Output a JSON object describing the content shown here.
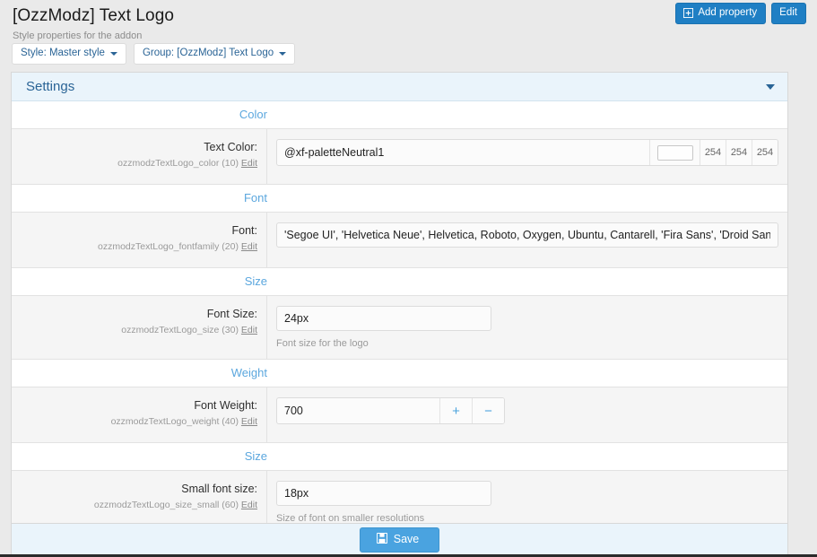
{
  "header": {
    "title": "[OzzModz] Text Logo",
    "subtitle": "Style properties for the addon",
    "add_property_label": "Add property",
    "add_property_icon": "plus-square-icon",
    "edit_label": "Edit"
  },
  "filters": {
    "style": "Style: Master style",
    "group": "Group: [OzzModz] Text Logo"
  },
  "panel": {
    "title": "Settings",
    "collapse_icon": "chevron-down-icon"
  },
  "sections": [
    {
      "title": "Color",
      "row": {
        "label": "Text Color:",
        "meta_key": "ozzmodzTextLogo_color (10)",
        "meta_edit": "Edit",
        "type": "color",
        "value": "@xf-paletteNeutral1",
        "swatch_color": "#fefefe",
        "rgb": [
          "254",
          "254",
          "254"
        ],
        "hint": ""
      }
    },
    {
      "title": "Font",
      "row": {
        "label": "Font:",
        "meta_key": "ozzmodzTextLogo_fontfamily (20)",
        "meta_edit": "Edit",
        "type": "text-wide",
        "value": "'Segoe UI', 'Helvetica Neue', Helvetica, Roboto, Oxygen, Ubuntu, Cantarell, 'Fira Sans', 'Droid Sans', sans-",
        "hint": ""
      }
    },
    {
      "title": "Size",
      "row": {
        "label": "Font Size:",
        "meta_key": "ozzmodzTextLogo_size (30)",
        "meta_edit": "Edit",
        "type": "text-fixed",
        "value": "24px",
        "hint": "Font size for the logo"
      }
    },
    {
      "title": "Weight",
      "row": {
        "label": "Font Weight:",
        "meta_key": "ozzmodzTextLogo_weight (40)",
        "meta_edit": "Edit",
        "type": "stepper",
        "value": "700",
        "increment_label": "+",
        "decrement_label": "−",
        "hint": ""
      }
    },
    {
      "title": "Size",
      "row": {
        "label": "Small font size:",
        "meta_key": "ozzmodzTextLogo_size_small (60)",
        "meta_edit": "Edit",
        "type": "text-fixed",
        "value": "18px",
        "hint": "Size of font on smaller resolutions"
      }
    }
  ],
  "footer": {
    "save_label": "Save",
    "save_icon": "floppy-disk-icon"
  },
  "colors": {
    "accent_blue": "#2a6496",
    "link_blue": "#5ba7de",
    "button_blue": "#1f7fc4",
    "save_blue": "#4aa3e0",
    "panel_header_bg": "#eaf4fb",
    "page_bg": "#eaeaea"
  }
}
